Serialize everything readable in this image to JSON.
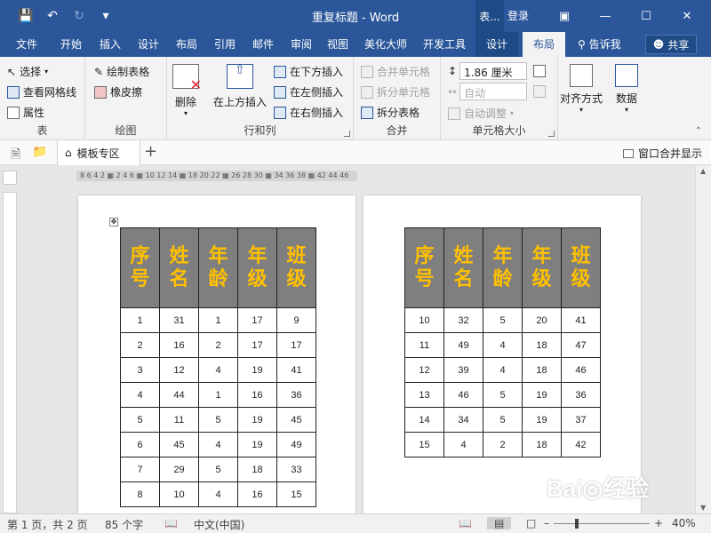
{
  "title_bar": {
    "document_title": "重复标题 - Word",
    "context_tab": "表...",
    "login": "登录",
    "icons": [
      "save-icon",
      "undo-icon",
      "redo-icon",
      "customize-qat-icon"
    ]
  },
  "tabs": [
    {
      "label": "文件"
    },
    {
      "label": "开始"
    },
    {
      "label": "插入"
    },
    {
      "label": "设计"
    },
    {
      "label": "布局"
    },
    {
      "label": "引用"
    },
    {
      "label": "邮件"
    },
    {
      "label": "审阅"
    },
    {
      "label": "视图"
    },
    {
      "label": "美化大师"
    },
    {
      "label": "开发工具"
    },
    {
      "label": "设计"
    },
    {
      "label": "布局"
    }
  ],
  "tell_me": "告诉我",
  "share": "共享",
  "ribbon": {
    "table": {
      "label": "表",
      "select": "选择",
      "view_grid": "查看网格线",
      "properties": "属性"
    },
    "draw": {
      "label": "绘图",
      "draw_table": "绘制表格",
      "eraser": "橡皮擦"
    },
    "rows_cols": {
      "label": "行和列",
      "delete": "删除",
      "insert_above": "在上方插入",
      "insert_below": "在下方插入",
      "insert_left": "在左侧插入",
      "insert_right": "在右侧插入"
    },
    "merge": {
      "label": "合并",
      "merge_cells": "合并单元格",
      "split_cells": "拆分单元格",
      "split_table": "拆分表格"
    },
    "cell_size": {
      "label": "单元格大小",
      "height": "1.86 厘米",
      "width": "自动",
      "autofit": "自动调整"
    },
    "alignment": {
      "label": "对齐方式"
    },
    "data": {
      "label": "数据"
    }
  },
  "doc_tab": {
    "label": "模板专区",
    "merge_window": "窗口合并显示"
  },
  "ruler_text": "8 6 4 2 ▦ 2 4 6 ▦ 10 12 14 ▦ 18 20 22 ▦ 26 28 30 ▦ 34 36 38 ▦ 42 44 46",
  "headers": [
    "序号",
    "姓名",
    "年龄",
    "年级",
    "班级"
  ],
  "page1_rows": [
    [
      "1",
      "31",
      "1",
      "17",
      "9"
    ],
    [
      "2",
      "16",
      "2",
      "17",
      "17"
    ],
    [
      "3",
      "12",
      "4",
      "19",
      "41"
    ],
    [
      "4",
      "44",
      "1",
      "16",
      "36"
    ],
    [
      "5",
      "11",
      "5",
      "19",
      "45"
    ],
    [
      "6",
      "45",
      "4",
      "19",
      "49"
    ],
    [
      "7",
      "29",
      "5",
      "18",
      "33"
    ],
    [
      "8",
      "10",
      "4",
      "16",
      "15"
    ]
  ],
  "page2_rows": [
    [
      "10",
      "32",
      "5",
      "20",
      "41"
    ],
    [
      "11",
      "49",
      "4",
      "18",
      "47"
    ],
    [
      "12",
      "39",
      "4",
      "18",
      "46"
    ],
    [
      "13",
      "46",
      "5",
      "19",
      "36"
    ],
    [
      "14",
      "34",
      "5",
      "19",
      "37"
    ],
    [
      "15",
      "4",
      "2",
      "18",
      "42"
    ]
  ],
  "status": {
    "page": "第 1 页，共 2 页",
    "words": "85 个字",
    "language": "中文(中国)",
    "zoom": "40%",
    "zoom_fraction": 0.4
  },
  "watermark": "Bai◎经验",
  "colors": {
    "brand": "#2b579a",
    "header_fill": "#7f7f7f",
    "header_text": "#ffc000"
  }
}
